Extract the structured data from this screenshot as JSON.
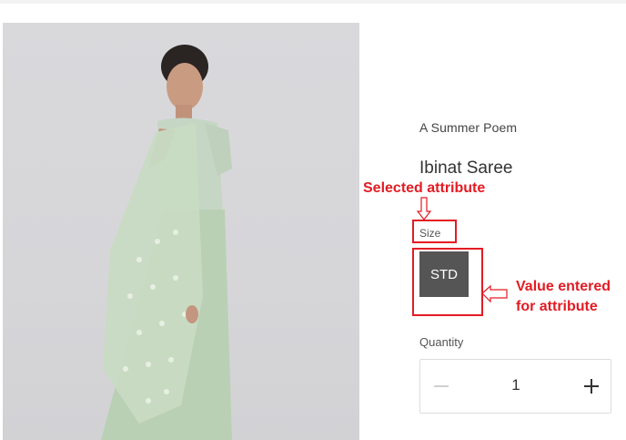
{
  "product": {
    "brand": "A Summer Poem",
    "name": "Ibinat Saree",
    "attribute_name": "Size",
    "attribute_value": "STD",
    "quantity_label": "Quantity",
    "quantity_value": "1",
    "image_colors": {
      "background": "#d7d7da",
      "garment": "#bcd2b6"
    }
  },
  "annotations": {
    "selected_attribute": "Selected attribute",
    "value_line1": "Value entered",
    "value_line2": "for attribute",
    "color": "#e31b23"
  }
}
